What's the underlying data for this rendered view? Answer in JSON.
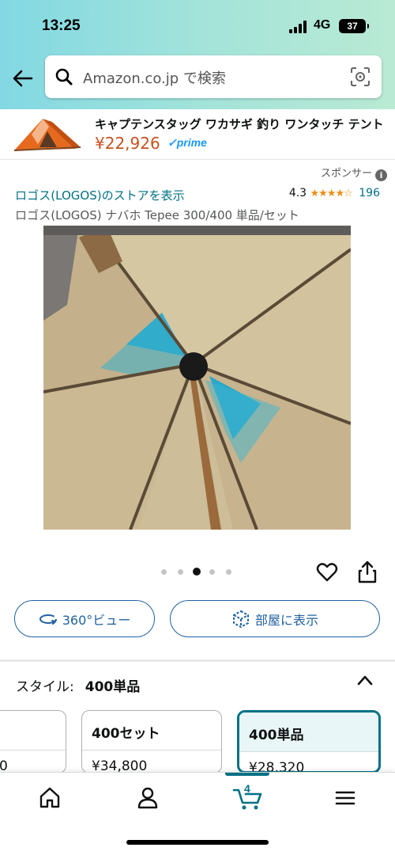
{
  "status": {
    "time": "13:25",
    "network": "4G",
    "battery": "37"
  },
  "search": {
    "placeholder": "Amazon.co.jp で検索"
  },
  "banner": {
    "title": "キャプテンスタッグ ワカサギ 釣り ワンタッチ テント",
    "price": "¥22,926",
    "prime": "✓prime"
  },
  "sponsor": {
    "label": "スポンサー",
    "info": "i"
  },
  "product": {
    "store_link": "ロゴス(LOGOS)のストアを表示",
    "rating": "4.3",
    "stars": "★★★★☆",
    "review_count": "196",
    "title": "ロゴス(LOGOS) ナバホ Tepee 300/400 単品/セット"
  },
  "carousel": {
    "total": 5,
    "active": 2
  },
  "actions": {
    "view360": "360°ビュー",
    "view_room": "部屋に表示"
  },
  "style": {
    "label": "スタイル:",
    "value": "400単品"
  },
  "options": [
    {
      "name": "",
      "price": "0"
    },
    {
      "name": "400セット",
      "price": "¥34,800"
    },
    {
      "name": "400単品",
      "price": "¥28,320",
      "selected": true
    }
  ],
  "nav": {
    "cart_count": "4",
    "active": "cart"
  },
  "colors": {
    "link": "#007185",
    "price": "#c7511f",
    "accent": "#2162a1",
    "star": "#ee8e15"
  },
  "icons": [
    "back-arrow-icon",
    "search-icon",
    "camera-scan-icon",
    "heart-icon",
    "share-icon",
    "rotate-360-icon",
    "cube-ar-icon",
    "chevron-up-icon",
    "home-icon",
    "account-icon",
    "cart-icon",
    "menu-icon"
  ]
}
